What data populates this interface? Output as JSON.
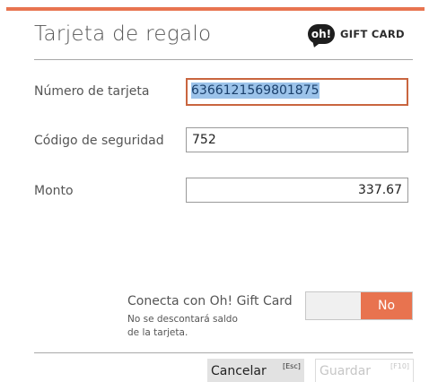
{
  "dialog": {
    "title": "Tarjeta de regalo",
    "logo_mark": "oh!",
    "logo_text": "GIFT CARD",
    "accent_color": "#e87450"
  },
  "form": {
    "card_number": {
      "label": "Número de tarjeta",
      "value": "6366121569801875"
    },
    "security_code": {
      "label": "Código de seguridad",
      "value": "752"
    },
    "amount": {
      "label": "Monto",
      "value": "337.67"
    }
  },
  "connect": {
    "label": "Conecta con Oh! Gift Card",
    "sub_line1": "No se descontará saldo",
    "sub_line2": "de la tarjeta.",
    "toggle_value": "No",
    "toggle_color": "#e8734f"
  },
  "footer": {
    "cancel_label": "Cancelar",
    "cancel_shortcut": "[Esc]",
    "save_label": "Guardar",
    "save_shortcut": "[F10]"
  }
}
